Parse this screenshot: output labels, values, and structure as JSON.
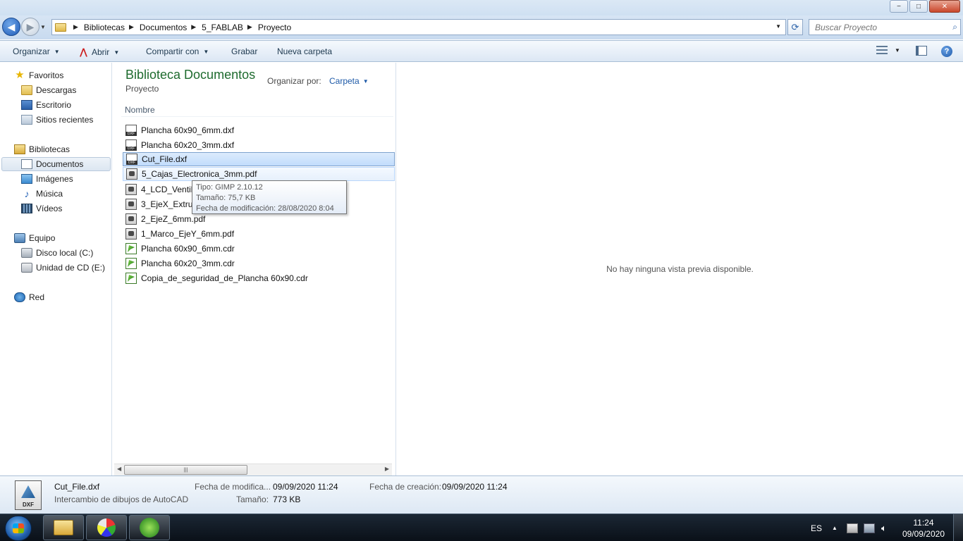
{
  "window": {
    "minimize": "−",
    "maximize": "□",
    "close": "✕"
  },
  "address": {
    "crumbs": [
      "Bibliotecas",
      "Documentos",
      "5_FABLAB",
      "Proyecto"
    ],
    "search_placeholder": "Buscar Proyecto"
  },
  "toolbar": {
    "organize": "Organizar",
    "open": "Abrir",
    "share": "Compartir con",
    "burn": "Grabar",
    "new_folder": "Nueva carpeta"
  },
  "nav": {
    "favorites": "Favoritos",
    "downloads": "Descargas",
    "desktop": "Escritorio",
    "recent": "Sitios recientes",
    "libraries": "Bibliotecas",
    "documents": "Documentos",
    "images": "Imágenes",
    "music": "Música",
    "videos": "Vídeos",
    "computer": "Equipo",
    "local_disk": "Disco local (C:)",
    "cd_drive": "Unidad de CD (E:)",
    "network": "Red"
  },
  "library": {
    "title": "Biblioteca Documentos",
    "subtitle": "Proyecto",
    "arrange_label": "Organizar por:",
    "arrange_value": "Carpeta",
    "column_name": "Nombre"
  },
  "files": [
    {
      "name": "Plancha 60x90_6mm.dxf",
      "type": "dxf"
    },
    {
      "name": "Plancha 60x20_3mm.dxf",
      "type": "dxf"
    },
    {
      "name": "Cut_File.dxf",
      "type": "dxf"
    },
    {
      "name": "5_Cajas_Electronica_3mm.pdf",
      "type": "pdf"
    },
    {
      "name": "4_LCD_Ventila",
      "type": "pdf"
    },
    {
      "name": "3_EjeX_Extrusor",
      "type": "pdf"
    },
    {
      "name": "2_EjeZ_6mm.pdf",
      "type": "pdf"
    },
    {
      "name": "1_Marco_EjeY_6mm.pdf",
      "type": "pdf"
    },
    {
      "name": "Plancha 60x90_6mm.cdr",
      "type": "cdr"
    },
    {
      "name": "Plancha 60x20_3mm.cdr",
      "type": "cdr"
    },
    {
      "name": "Copia_de_seguridad_de_Plancha 60x90.cdr",
      "type": "cdr"
    }
  ],
  "tooltip": {
    "type": "Tipo: GIMP 2.10.12",
    "size": "Tamaño: 75,7 KB",
    "modified": "Fecha de modificación: 28/08/2020 8:04"
  },
  "preview": {
    "message": "No hay ninguna vista previa disponible."
  },
  "details": {
    "icon_label": "DXF",
    "name": "Cut_File.dxf",
    "type": "Intercambio de dibujos de AutoCAD",
    "modified_label": "Fecha de modifica...",
    "modified_value": "09/09/2020 11:24",
    "created_label": "Fecha de creación:",
    "created_value": "09/09/2020 11:24",
    "size_label": "Tamaño:",
    "size_value": "773 KB"
  },
  "taskbar": {
    "language": "ES",
    "time": "11:24",
    "date": "09/09/2020"
  }
}
